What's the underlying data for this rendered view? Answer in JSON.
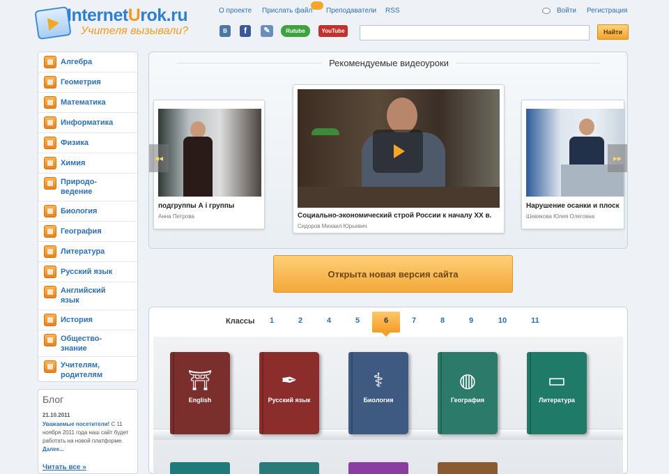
{
  "header": {
    "logo_prefix": "Internet",
    "logo_u": "U",
    "logo_suffix": "rok.ru",
    "slogan": "Учителя вызывали?",
    "links": [
      "О проекте",
      "Прислать файл",
      "Преподаватели",
      "RSS"
    ],
    "login": "Войти",
    "register": "Регистрация",
    "social": [
      {
        "name": "vkontakte-icon",
        "text": "В",
        "color": "#4a76a8"
      },
      {
        "name": "facebook-icon",
        "text": "f",
        "color": "#3b5998"
      },
      {
        "name": "livejournal-icon",
        "text": "✎",
        "color": "#6a8fb8"
      },
      {
        "name": "rutube-icon",
        "text": "Rutube",
        "color": "#3fa23f"
      },
      {
        "name": "youtube-icon",
        "text": "YouTube",
        "color": "#c4302b"
      }
    ],
    "search_placeholder": "",
    "search_button": "Найти"
  },
  "sidebar": {
    "items": [
      {
        "label": "Алгебра"
      },
      {
        "label": "Геометрия"
      },
      {
        "label": "Математика"
      },
      {
        "label": "Информатика"
      },
      {
        "label": "Физика"
      },
      {
        "label": "Химия"
      },
      {
        "label": "Природо-ведение"
      },
      {
        "label": "Биология"
      },
      {
        "label": "География"
      },
      {
        "label": "Литература"
      },
      {
        "label": "Русский язык"
      },
      {
        "label": "Английский язык"
      },
      {
        "label": "История"
      },
      {
        "label": "Общество-знание"
      },
      {
        "label": "Учителям, родителям"
      }
    ]
  },
  "blog": {
    "title": "Блог",
    "date": "21.10.2011",
    "text_bold": "Уважаемые посетители!",
    "text": "С 11 ноября 2011 года наш сайт будет работать на новой платформе.",
    "more": "Далее...",
    "all_posts": "Читать все »"
  },
  "recommended": {
    "title": "Рекомендуемые видеоуроки",
    "prev_arrow": "◂◂",
    "next_arrow": "▸▸",
    "videos": [
      {
        "caption": "подгруппы А і группы",
        "author": "Анна Петрова"
      },
      {
        "caption": "Социально-экономический строй России к началу XX в.",
        "author": "Сидоров Михаил Юрьевич"
      },
      {
        "caption": "Нарушение осанки и плоск",
        "author": "Шевякова Юлия Олеговна"
      }
    ]
  },
  "new_version_button": "Открыта новая версия сайта",
  "grades": {
    "label": "Классы",
    "numbers": [
      "1",
      "2",
      "4",
      "5",
      "6",
      "7",
      "8",
      "9",
      "10",
      "11"
    ],
    "active": "6"
  },
  "books": [
    {
      "title": "English",
      "color": "#7a2f2c",
      "icon": "⛩"
    },
    {
      "title": "Русский язык",
      "color": "#8a2d2b",
      "icon": "✒"
    },
    {
      "title": "Биология",
      "color": "#3f5a80",
      "icon": "⚕"
    },
    {
      "title": "География",
      "color": "#2c7a6a",
      "icon": "◍"
    },
    {
      "title": "Литература",
      "color": "#1f7a68",
      "icon": "📖"
    }
  ],
  "bottom_books_colors": [
    "#1f7a7a",
    "#7a2f5a",
    "#8a3fa0",
    "#8a5a30"
  ]
}
